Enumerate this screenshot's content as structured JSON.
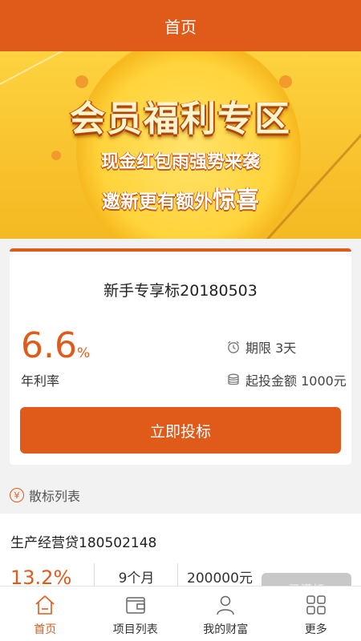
{
  "header": {
    "title": "首页"
  },
  "banner": {
    "title": "会员福利专区",
    "line1": "现金红包雨强势来袭",
    "line2_prefix": "邀新更有额外",
    "line2_emphasis": "惊喜"
  },
  "featured": {
    "name": "新手专享标20180503",
    "rate": "6.6",
    "rate_unit": "%",
    "rate_label": "年利率",
    "term": "期限 3天",
    "min_invest": "起投金额 1000元",
    "button_label": "立即投标"
  },
  "section": {
    "icon_glyph": "¥",
    "title": "散标列表"
  },
  "loan": {
    "name": "生产经营贷180502148",
    "rate": "13.2%",
    "term": "9个月",
    "amount": "200000元",
    "status": "已满标"
  },
  "tabbar": {
    "items": [
      {
        "label": "首页",
        "icon": "home-icon",
        "active": true
      },
      {
        "label": "项目列表",
        "icon": "wallet-icon",
        "active": false
      },
      {
        "label": "我的财富",
        "icon": "user-icon",
        "active": false
      },
      {
        "label": "更多",
        "icon": "grid-icon",
        "active": false
      }
    ]
  },
  "colors": {
    "accent": "#e05a1a",
    "banner_bg": "#fcce3a"
  }
}
